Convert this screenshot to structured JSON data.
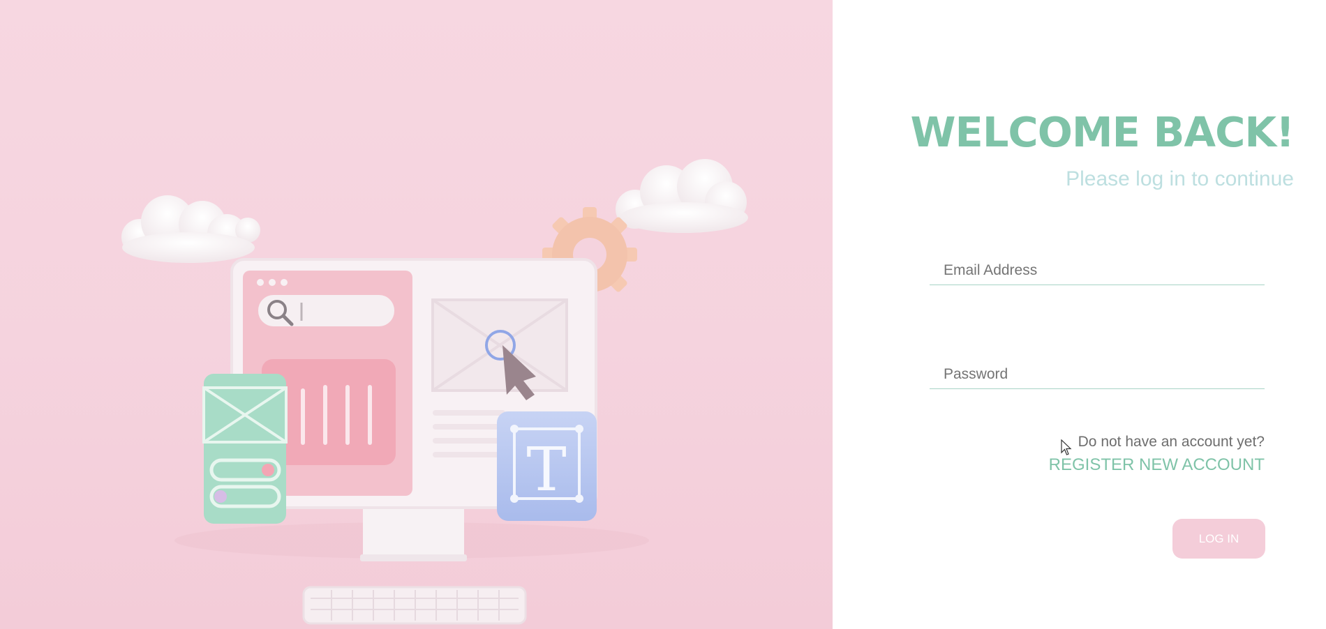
{
  "login": {
    "title": "WELCOME BACK!",
    "subtitle": "Please log in to continue",
    "email_placeholder": "Email Address",
    "password_placeholder": "Password",
    "register_prompt": "Do not have an account yet?",
    "register_link": "REGISTER NEW ACCOUNT",
    "login_button": "LOG IN"
  },
  "colors": {
    "accent_green": "#7fc3a8",
    "subtitle_teal": "#bddfe0",
    "button_pink": "#f4cdd9",
    "hero_pink": "#f5d3de"
  },
  "hero": {
    "monogram": "T"
  }
}
